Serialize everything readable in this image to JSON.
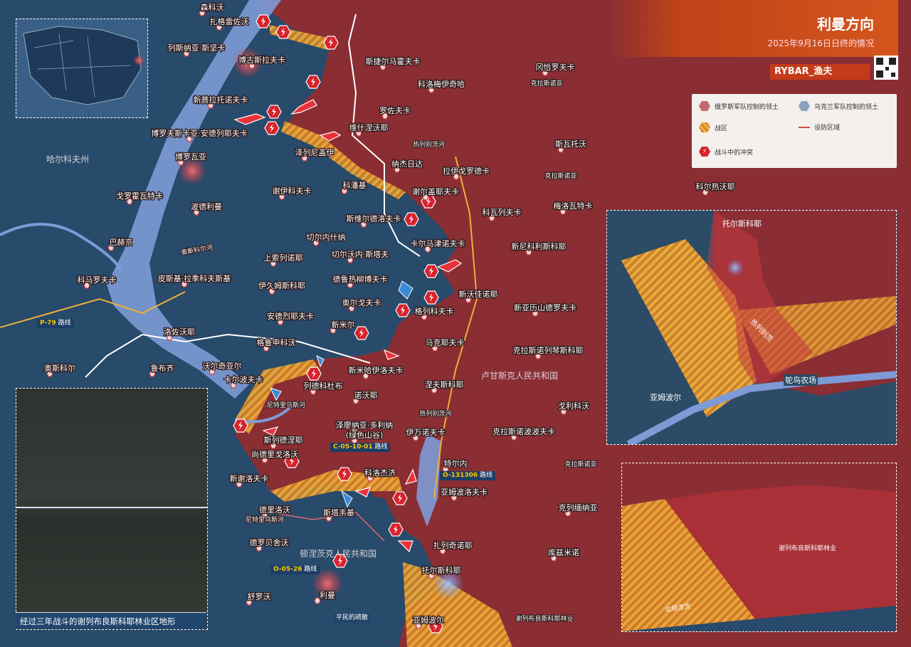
{
  "header": {
    "title": "利曼方向",
    "subtitle": "2025年9月16日日终的情况",
    "brand": "RYBAR_渔夫"
  },
  "legend": {
    "russian_territory": "俄罗斯军队控制的领土",
    "ukrainian_territory": "乌克兰军队控制的领土",
    "combat_zone": "战区",
    "defense_zone": "设防区域",
    "clashes": "战斗中的冲突"
  },
  "colors": {
    "russian": "#8a2e34",
    "ukrainian": "#284a6b",
    "river": "#7d9bd6",
    "combat": "#e5962d",
    "accent": "#d4551c"
  },
  "towns": [
    {
      "name": "森科沃"
    },
    {
      "name": "扎格雷佐沃"
    },
    {
      "name": "列斯纳亚·斯坚卡"
    },
    {
      "name": "博古斯拉夫卡"
    },
    {
      "name": "新普拉托诺夫卡"
    },
    {
      "name": "博罗夫斯卡亚·安德列耶夫卡"
    },
    {
      "name": "博罗瓦亚"
    },
    {
      "name": "戈罗霍瓦特卡"
    },
    {
      "name": "波德利曼"
    },
    {
      "name": "巴赫京"
    },
    {
      "name": "谢伊科夫卡"
    },
    {
      "name": "斯捷尔马霍夫卡"
    },
    {
      "name": "科洛梅伊奇哈"
    },
    {
      "name": "罗佐夫卡"
    },
    {
      "name": "维什涅沃耶"
    },
    {
      "name": "泽列尼盖伊"
    },
    {
      "name": "纳杰日达"
    },
    {
      "name": "拉伊戈罗德卡"
    },
    {
      "name": "科潘基"
    },
    {
      "name": "谢尔盖耶夫卡"
    },
    {
      "name": "斯维尔德洛夫卡"
    },
    {
      "name": "科瓦列夫卡"
    },
    {
      "name": "切尔内什纳"
    },
    {
      "name": "卡尔马津诺夫卡"
    },
    {
      "name": "上索列诺耶"
    },
    {
      "name": "切尔沃内·斯塔夫"
    },
    {
      "name": "伊久姆斯科耶"
    },
    {
      "name": "德鲁热柳博夫卡"
    },
    {
      "name": "皮斯基·拉季科夫斯基"
    },
    {
      "name": "科马罗夫卡"
    },
    {
      "name": "新沃佳诺耶"
    },
    {
      "name": "奥尔戈夫卡"
    },
    {
      "name": "格列科夫卡"
    },
    {
      "name": "安德烈耶夫卡"
    },
    {
      "name": "新米尔"
    },
    {
      "name": "洛佐沃耶"
    },
    {
      "name": "格鲁申科沃"
    },
    {
      "name": "马克耶夫卡"
    },
    {
      "name": "奥斯科尔"
    },
    {
      "name": "鲁布齐"
    },
    {
      "name": "沃尔奇亚尔"
    },
    {
      "name": "卡尔波夫卡"
    },
    {
      "name": "新米哈伊洛夫卡"
    },
    {
      "name": "列德科杜布"
    },
    {
      "name": "诺沃耶"
    },
    {
      "name": "涅夫斯科耶"
    },
    {
      "name": "斯列德涅耶"
    },
    {
      "name": "泽廖纳亚·多利纳"
    },
    {
      "name": "(绿色山谷)"
    },
    {
      "name": "伊万诺夫卡"
    },
    {
      "name": "尚德里戈洛沃"
    },
    {
      "name": "新谢洛夫卡"
    },
    {
      "name": "科洛杰济"
    },
    {
      "name": "特尔内"
    },
    {
      "name": "亚姆波洛夫卡"
    },
    {
      "name": "德里洛沃"
    },
    {
      "name": "斯塔韦基"
    },
    {
      "name": "德罗贝舍沃"
    },
    {
      "name": "扎列奇诺耶"
    },
    {
      "name": "托尔斯科耶"
    },
    {
      "name": "舒罗沃"
    },
    {
      "name": "利曼"
    },
    {
      "name": "亚姆波尔"
    },
    {
      "name": "冈恰罗夫卡"
    },
    {
      "name": "斯瓦托沃"
    },
    {
      "name": "科尔热沃耶"
    },
    {
      "name": "梅洛瓦特卡"
    },
    {
      "name": "新尼科利斯科耶"
    },
    {
      "name": "新亚历山德罗夫卡"
    },
    {
      "name": "克拉斯诺列琴斯科耶"
    },
    {
      "name": "戈利科沃"
    },
    {
      "name": "克拉斯诺波波夫卡"
    },
    {
      "name": "克列缅纳亚"
    },
    {
      "name": "库兹米诺"
    }
  ],
  "regions": {
    "kharkiv": "哈尔科夫州",
    "luhansk": "卢甘斯克人民共和国",
    "donetsk": "顿涅茨克人民共和国"
  },
  "rivers": [
    "奥斯科尔河",
    "热列别茨河",
    "尼特里乌斯河",
    "尼特里乌斯河",
    "热列别茨",
    "北顿涅茨"
  ],
  "small_labels": [
    "克拉斯诺亚",
    "克拉斯诺亚",
    "克拉斯诺亚",
    "谢列布良斯科耶林业",
    "平民的疏散"
  ],
  "roads": [
    {
      "code": "P-79",
      "suffix": "路线"
    },
    {
      "code": "C-05-10-01",
      "suffix": "路线"
    },
    {
      "code": "O-131306",
      "suffix": "路线"
    },
    {
      "code": "O-05-26",
      "suffix": "路线"
    }
  ],
  "insets": {
    "tor_inset": {
      "town_top": "托尔斯科耶",
      "town_bottom": "亚姆波尔",
      "farm": "鸵鸟农场",
      "river": "热列别茨"
    },
    "forest_inset": {
      "label": "谢列布良斯科耶林业",
      "river": "北顿涅茨"
    },
    "satellite_caption": "经过三年战斗的谢列布良斯科耶林业区地形"
  }
}
